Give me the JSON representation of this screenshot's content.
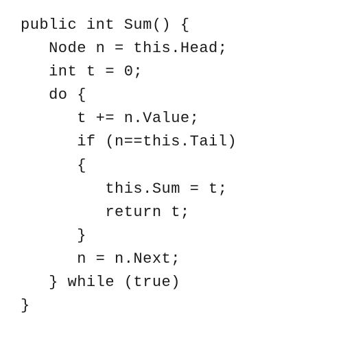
{
  "code": {
    "lines": [
      "public int Sum() {",
      "   Node n = this.Head;",
      "   int t = 0;",
      "   do {",
      "      t += n.Value;",
      "      if (n==this.Tail)",
      "      {",
      "         this.Sum = t;",
      "         return t;",
      "      }",
      "      n = n.Next;",
      "   } while (true)",
      "}"
    ]
  }
}
